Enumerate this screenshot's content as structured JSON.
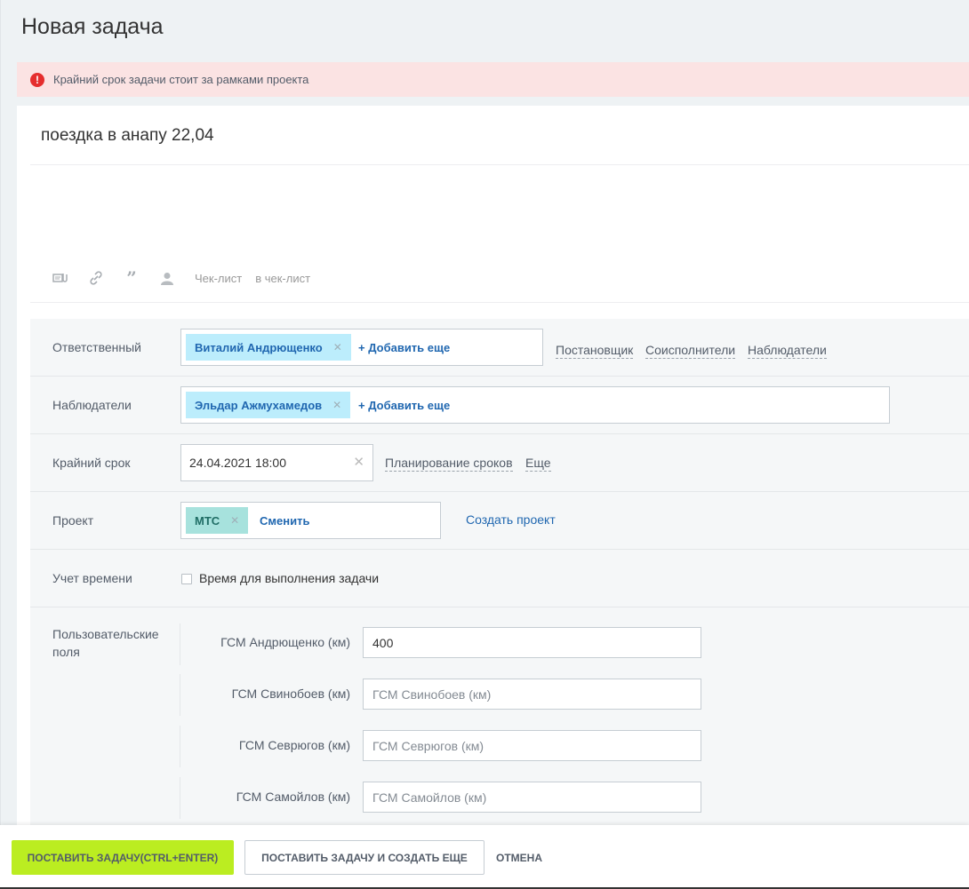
{
  "page": {
    "title": "Новая задача"
  },
  "alert": {
    "icon": "exclamation-icon",
    "text": "Крайний срок задачи стоит за рамками проекта"
  },
  "task": {
    "title": "поездка в анапу 22,04"
  },
  "toolbar": {
    "icons": [
      "attach-file-icon",
      "link-icon",
      "quote-icon",
      "mention-user-icon"
    ],
    "checklist_label": "Чек-лист",
    "to_checklist_label": "в чек-лист"
  },
  "form": {
    "responsible": {
      "label": "Ответственный",
      "tag": "Виталий Андрющенко",
      "add_more": "+ Добавить еще",
      "links": [
        "Постановщик",
        "Соисполнители",
        "Наблюдатели"
      ]
    },
    "observers": {
      "label": "Наблюдатели",
      "tag": "Эльдар Ажмухамедов",
      "add_more": "+ Добавить еще"
    },
    "deadline": {
      "label": "Крайний срок",
      "value": "24.04.2021 18:00",
      "planning_link": "Планирование сроков",
      "more_link": "Еще"
    },
    "project": {
      "label": "Проект",
      "tag": "МТС",
      "change_link": "Сменить",
      "create_link": "Создать проект"
    },
    "time_tracking": {
      "label": "Учет времени",
      "checkbox_label": "Время для выполнения задачи",
      "checked": false
    },
    "custom_fields": {
      "label": "Пользовательские поля",
      "fields": [
        {
          "label": "ГСМ Андрющенко (км)",
          "value": "400",
          "placeholder": ""
        },
        {
          "label": "ГСМ Свинобоев (км)",
          "value": "",
          "placeholder": "ГСМ Свинобоев (км)"
        },
        {
          "label": "ГСМ Севрюгов (км)",
          "value": "",
          "placeholder": "ГСМ Севрюгов (км)"
        },
        {
          "label": "ГСМ Самойлов (км)",
          "value": "",
          "placeholder": "ГСМ Самойлов (км)"
        }
      ]
    }
  },
  "footer": {
    "submit_label": "ПОСТАВИТЬ ЗАДАЧУ(CTRL+ENTER)",
    "submit_and_create_label": "ПОСТАВИТЬ ЗАДАЧУ И СОЗДАТЬ ЕЩЕ",
    "cancel_label": "ОТМЕНА"
  },
  "colors": {
    "primary_button": "#bbed21",
    "alert_bg": "#fbe3e3",
    "alert_icon": "#e52e2e",
    "link": "#2067b0",
    "user_tag": "#bcedfc",
    "project_tag": "#a7e2dd"
  }
}
